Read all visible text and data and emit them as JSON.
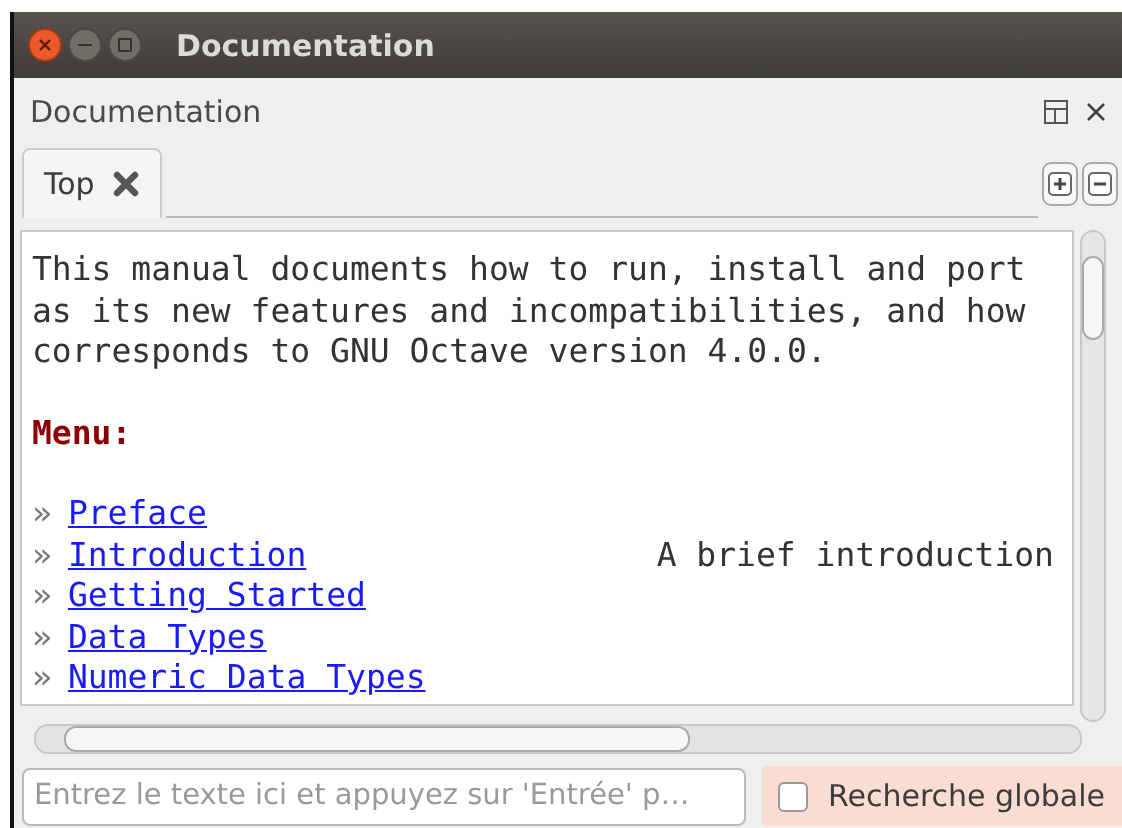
{
  "window": {
    "title": "Documentation"
  },
  "panel": {
    "title": "Documentation"
  },
  "tabs": [
    {
      "label": "Top",
      "selected": true
    }
  ],
  "content": {
    "lines": [
      "This manual documents how to run, install and port",
      "as its new features and incompatibilities, and how",
      "corresponds to GNU Octave version 4.0.0."
    ],
    "menu_heading": "Menu:",
    "menu_items": [
      {
        "bullet": "»",
        "link": "Preface"
      },
      {
        "bullet": "»",
        "link": "Introduction",
        "description": "A brief introduction"
      },
      {
        "bullet": "»",
        "link": "Getting Started"
      },
      {
        "bullet": "»",
        "link": "Data Types"
      },
      {
        "bullet": "»",
        "link": "Numeric Data Types"
      }
    ]
  },
  "search": {
    "placeholder": "Entrez le texte ici et appuyez sur 'Entrée' p…"
  },
  "global_search": {
    "label": "Recherche globale",
    "checked": false
  }
}
